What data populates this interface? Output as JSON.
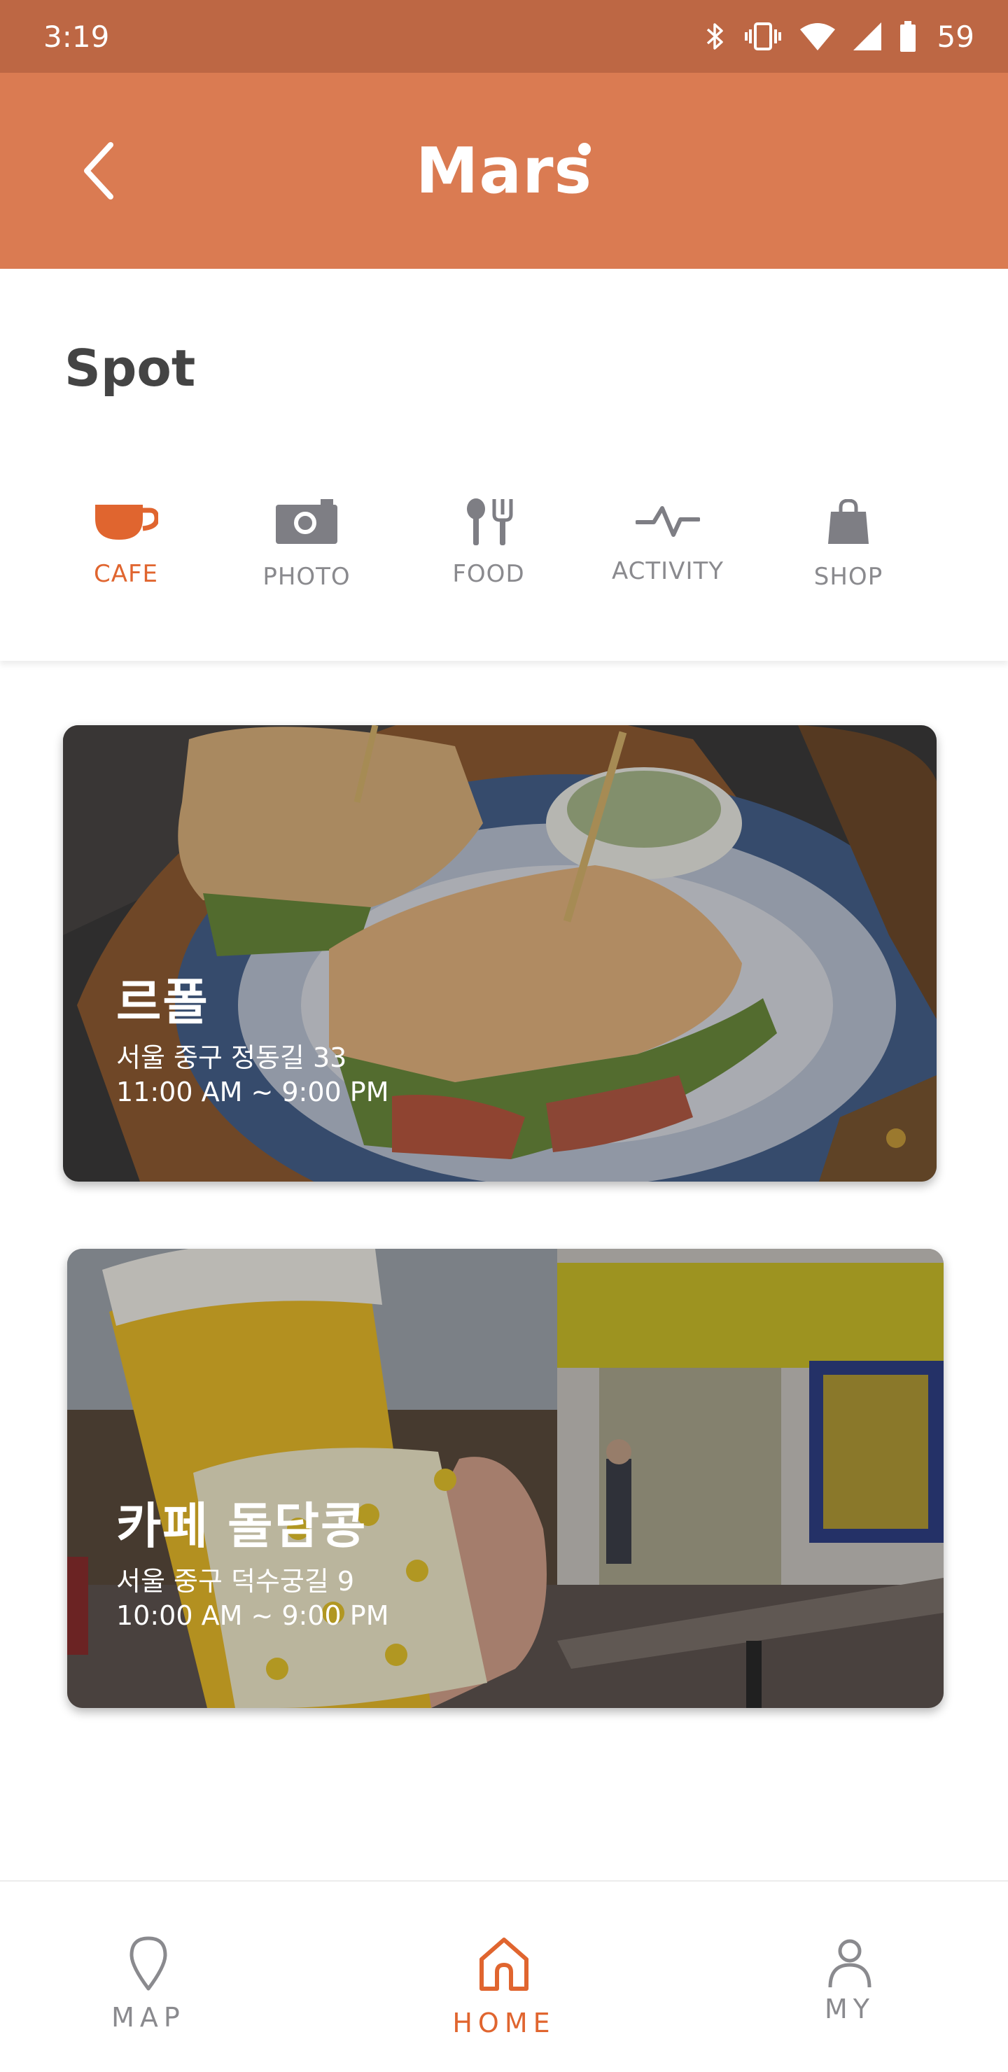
{
  "status_bar": {
    "time": "3:19",
    "battery": "59",
    "icons": [
      "bluetooth-icon",
      "vibrate-icon",
      "wifi-icon",
      "signal-icon",
      "battery-icon"
    ]
  },
  "app_bar": {
    "title": "Mars",
    "back_icon": "chevron-left-icon"
  },
  "spot": {
    "title": "Spot",
    "categories": [
      {
        "label": "CAFE",
        "icon": "coffee-cup-icon",
        "active": true
      },
      {
        "label": "PHOTO",
        "icon": "camera-icon",
        "active": false
      },
      {
        "label": "FOOD",
        "icon": "utensils-icon",
        "active": false
      },
      {
        "label": "ACTIVITY",
        "icon": "pulse-icon",
        "active": false
      },
      {
        "label": "SHOP",
        "icon": "shopping-bag-icon",
        "active": false
      }
    ]
  },
  "places": [
    {
      "name": "르폴",
      "address": "서울 중구 정동길 33",
      "hours": "11:00 AM ~ 9:00 PM"
    },
    {
      "name": "카페 돌담콩",
      "address": "서울 중구 덕수궁길 9",
      "hours": "10:00 AM ~ 9:00 PM"
    }
  ],
  "bottom_nav": {
    "items": [
      {
        "label": "MAP",
        "icon": "map-pin-icon",
        "active": false
      },
      {
        "label": "HOME",
        "icon": "home-icon",
        "active": true
      },
      {
        "label": "MY",
        "icon": "person-icon",
        "active": false
      }
    ]
  },
  "colors": {
    "status_bar": "#bd6744",
    "app_bar": "#da7b52",
    "accent": "#e0652f",
    "inactive": "#8a8a8e"
  }
}
